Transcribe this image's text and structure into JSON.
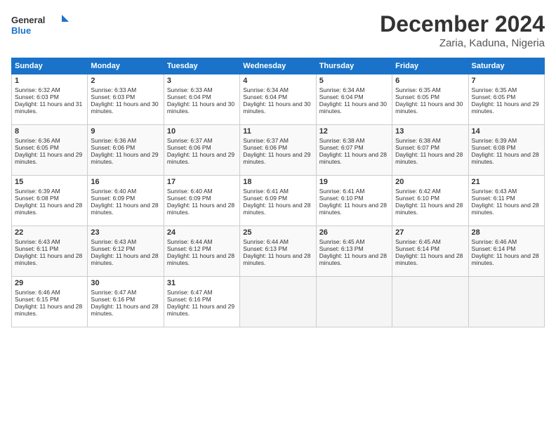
{
  "logo": {
    "line1": "General",
    "line2": "Blue"
  },
  "title": "December 2024",
  "subtitle": "Zaria, Kaduna, Nigeria",
  "days_of_week": [
    "Sunday",
    "Monday",
    "Tuesday",
    "Wednesday",
    "Thursday",
    "Friday",
    "Saturday"
  ],
  "weeks": [
    [
      {
        "day": 1,
        "sunrise": "6:32 AM",
        "sunset": "6:03 PM",
        "daylight": "11 hours and 31 minutes."
      },
      {
        "day": 2,
        "sunrise": "6:33 AM",
        "sunset": "6:03 PM",
        "daylight": "11 hours and 30 minutes."
      },
      {
        "day": 3,
        "sunrise": "6:33 AM",
        "sunset": "6:04 PM",
        "daylight": "11 hours and 30 minutes."
      },
      {
        "day": 4,
        "sunrise": "6:34 AM",
        "sunset": "6:04 PM",
        "daylight": "11 hours and 30 minutes."
      },
      {
        "day": 5,
        "sunrise": "6:34 AM",
        "sunset": "6:04 PM",
        "daylight": "11 hours and 30 minutes."
      },
      {
        "day": 6,
        "sunrise": "6:35 AM",
        "sunset": "6:05 PM",
        "daylight": "11 hours and 30 minutes."
      },
      {
        "day": 7,
        "sunrise": "6:35 AM",
        "sunset": "6:05 PM",
        "daylight": "11 hours and 29 minutes."
      }
    ],
    [
      {
        "day": 8,
        "sunrise": "6:36 AM",
        "sunset": "6:05 PM",
        "daylight": "11 hours and 29 minutes."
      },
      {
        "day": 9,
        "sunrise": "6:36 AM",
        "sunset": "6:06 PM",
        "daylight": "11 hours and 29 minutes."
      },
      {
        "day": 10,
        "sunrise": "6:37 AM",
        "sunset": "6:06 PM",
        "daylight": "11 hours and 29 minutes."
      },
      {
        "day": 11,
        "sunrise": "6:37 AM",
        "sunset": "6:06 PM",
        "daylight": "11 hours and 29 minutes."
      },
      {
        "day": 12,
        "sunrise": "6:38 AM",
        "sunset": "6:07 PM",
        "daylight": "11 hours and 28 minutes."
      },
      {
        "day": 13,
        "sunrise": "6:38 AM",
        "sunset": "6:07 PM",
        "daylight": "11 hours and 28 minutes."
      },
      {
        "day": 14,
        "sunrise": "6:39 AM",
        "sunset": "6:08 PM",
        "daylight": "11 hours and 28 minutes."
      }
    ],
    [
      {
        "day": 15,
        "sunrise": "6:39 AM",
        "sunset": "6:08 PM",
        "daylight": "11 hours and 28 minutes."
      },
      {
        "day": 16,
        "sunrise": "6:40 AM",
        "sunset": "6:09 PM",
        "daylight": "11 hours and 28 minutes."
      },
      {
        "day": 17,
        "sunrise": "6:40 AM",
        "sunset": "6:09 PM",
        "daylight": "11 hours and 28 minutes."
      },
      {
        "day": 18,
        "sunrise": "6:41 AM",
        "sunset": "6:09 PM",
        "daylight": "11 hours and 28 minutes."
      },
      {
        "day": 19,
        "sunrise": "6:41 AM",
        "sunset": "6:10 PM",
        "daylight": "11 hours and 28 minutes."
      },
      {
        "day": 20,
        "sunrise": "6:42 AM",
        "sunset": "6:10 PM",
        "daylight": "11 hours and 28 minutes."
      },
      {
        "day": 21,
        "sunrise": "6:43 AM",
        "sunset": "6:11 PM",
        "daylight": "11 hours and 28 minutes."
      }
    ],
    [
      {
        "day": 22,
        "sunrise": "6:43 AM",
        "sunset": "6:11 PM",
        "daylight": "11 hours and 28 minutes."
      },
      {
        "day": 23,
        "sunrise": "6:43 AM",
        "sunset": "6:12 PM",
        "daylight": "11 hours and 28 minutes."
      },
      {
        "day": 24,
        "sunrise": "6:44 AM",
        "sunset": "6:12 PM",
        "daylight": "11 hours and 28 minutes."
      },
      {
        "day": 25,
        "sunrise": "6:44 AM",
        "sunset": "6:13 PM",
        "daylight": "11 hours and 28 minutes."
      },
      {
        "day": 26,
        "sunrise": "6:45 AM",
        "sunset": "6:13 PM",
        "daylight": "11 hours and 28 minutes."
      },
      {
        "day": 27,
        "sunrise": "6:45 AM",
        "sunset": "6:14 PM",
        "daylight": "11 hours and 28 minutes."
      },
      {
        "day": 28,
        "sunrise": "6:46 AM",
        "sunset": "6:14 PM",
        "daylight": "11 hours and 28 minutes."
      }
    ],
    [
      {
        "day": 29,
        "sunrise": "6:46 AM",
        "sunset": "6:15 PM",
        "daylight": "11 hours and 28 minutes."
      },
      {
        "day": 30,
        "sunrise": "6:47 AM",
        "sunset": "6:16 PM",
        "daylight": "11 hours and 28 minutes."
      },
      {
        "day": 31,
        "sunrise": "6:47 AM",
        "sunset": "6:16 PM",
        "daylight": "11 hours and 29 minutes."
      },
      null,
      null,
      null,
      null
    ]
  ]
}
